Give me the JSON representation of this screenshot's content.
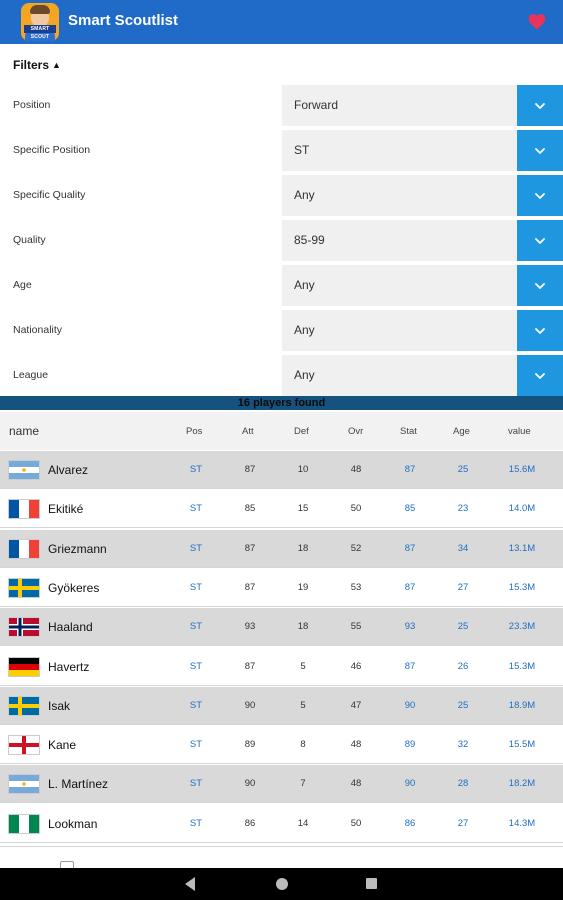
{
  "app": {
    "title": "Smart Scoutlist",
    "logo_text": "SMART SCOUT"
  },
  "filters": {
    "toggle_label": "Filters",
    "toggle_arrow": "▲",
    "rows": [
      {
        "label": "Position",
        "value": "Forward"
      },
      {
        "label": "Specific Position",
        "value": "ST"
      },
      {
        "label": "Specific Quality",
        "value": "Any"
      },
      {
        "label": "Quality",
        "value": "85-99"
      },
      {
        "label": "Age",
        "value": "Any"
      },
      {
        "label": "Nationality",
        "value": "Any"
      },
      {
        "label": "League",
        "value": "Any"
      }
    ]
  },
  "results": {
    "count_text": "16 players found"
  },
  "table": {
    "headers": {
      "name": "name",
      "pos": "Pos",
      "att": "Att",
      "def": "Def",
      "ovr": "Ovr",
      "stat": "Stat",
      "age": "Age",
      "value": "value"
    },
    "rows": [
      {
        "flag": "argentina",
        "name": "Alvarez",
        "pos": "ST",
        "att": "87",
        "def": "10",
        "ovr": "48",
        "stat": "87",
        "age": "25",
        "value": "15.6M"
      },
      {
        "flag": "france",
        "name": "Ekitiké",
        "pos": "ST",
        "att": "85",
        "def": "15",
        "ovr": "50",
        "stat": "85",
        "age": "23",
        "value": "14.0M"
      },
      {
        "flag": "france",
        "name": "Griezmann",
        "pos": "ST",
        "att": "87",
        "def": "18",
        "ovr": "52",
        "stat": "87",
        "age": "34",
        "value": "13.1M"
      },
      {
        "flag": "sweden",
        "name": "Gyökeres",
        "pos": "ST",
        "att": "87",
        "def": "19",
        "ovr": "53",
        "stat": "87",
        "age": "27",
        "value": "15.3M"
      },
      {
        "flag": "norway",
        "name": "Haaland",
        "pos": "ST",
        "att": "93",
        "def": "18",
        "ovr": "55",
        "stat": "93",
        "age": "25",
        "value": "23.3M"
      },
      {
        "flag": "germany",
        "name": "Havertz",
        "pos": "ST",
        "att": "87",
        "def": "5",
        "ovr": "46",
        "stat": "87",
        "age": "26",
        "value": "15.3M"
      },
      {
        "flag": "sweden",
        "name": "Isak",
        "pos": "ST",
        "att": "90",
        "def": "5",
        "ovr": "47",
        "stat": "90",
        "age": "25",
        "value": "18.9M"
      },
      {
        "flag": "england",
        "name": "Kane",
        "pos": "ST",
        "att": "89",
        "def": "8",
        "ovr": "48",
        "stat": "89",
        "age": "32",
        "value": "15.5M"
      },
      {
        "flag": "argentina",
        "name": "L. Martínez",
        "pos": "ST",
        "att": "90",
        "def": "7",
        "ovr": "48",
        "stat": "90",
        "age": "28",
        "value": "18.2M"
      },
      {
        "flag": "nigeria",
        "name": "Lookman",
        "pos": "ST",
        "att": "86",
        "def": "14",
        "ovr": "50",
        "stat": "86",
        "age": "27",
        "value": "14.3M"
      }
    ]
  },
  "colors": {
    "appbar": "#1f6bc7",
    "dropdown_button": "#1e96e0",
    "results_bar": "#15527d",
    "row_alt": "#d9d9d9",
    "accent_text": "#1e6fc2",
    "heart": "#e8335a"
  },
  "icons": {
    "heart": "heart-icon",
    "chevron": "chevron-down-icon",
    "back": "nav-back-icon",
    "home": "nav-home-icon",
    "recent": "nav-recent-icon"
  }
}
